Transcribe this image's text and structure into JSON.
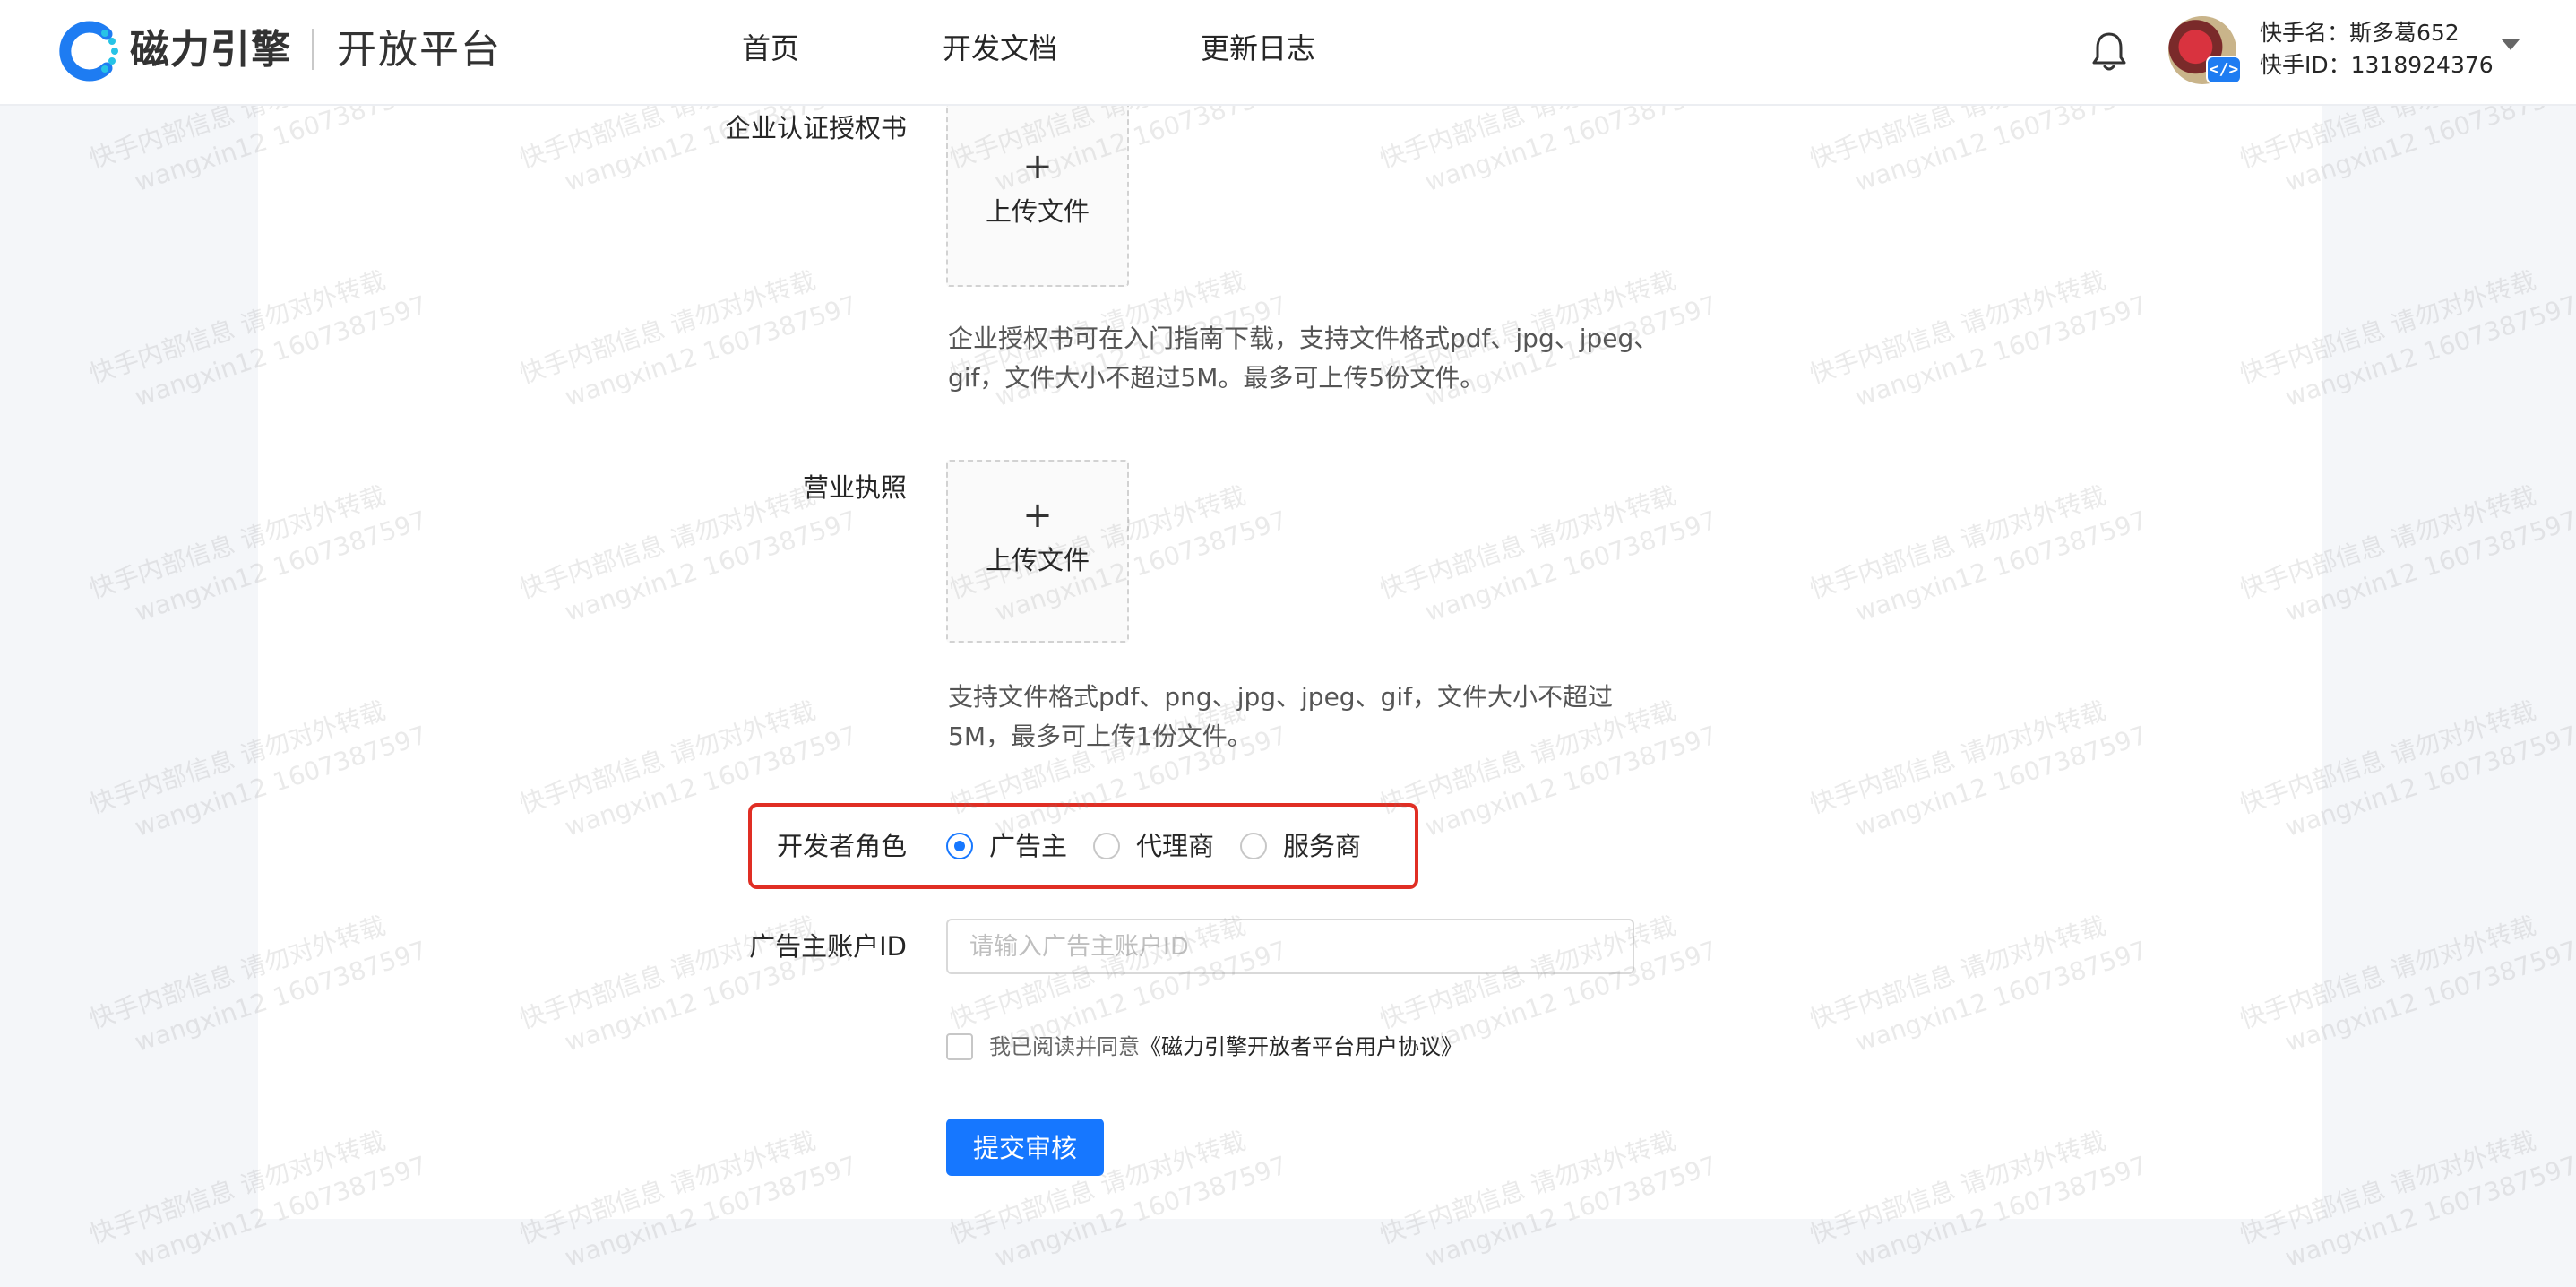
{
  "header": {
    "brand_name": "磁力引擎",
    "platform_name": "开放平台",
    "nav": [
      "首页",
      "开发文档",
      "更新日志"
    ],
    "user": {
      "name_line": "快手名：斯多葛652",
      "id_line": "快手ID：1318924376",
      "avatar_badge": "</>"
    }
  },
  "form": {
    "auth_letter": {
      "label": "企业认证授权书",
      "upload_plus": "+",
      "upload_text": "上传文件",
      "hint": "企业授权书可在入门指南下载，支持文件格式pdf、jpg、jpeg、gif，文件大小不超过5M。最多可上传5份文件。"
    },
    "business_license": {
      "label": "营业执照",
      "upload_plus": "+",
      "upload_text": "上传文件",
      "hint": "支持文件格式pdf、png、jpg、jpeg、gif，文件大小不超过5M，最多可上传1份文件。"
    },
    "developer_role": {
      "label": "开发者角色",
      "options": [
        "广告主",
        "代理商",
        "服务商"
      ],
      "selected": "广告主"
    },
    "advertiser_id": {
      "label": "广告主账户ID",
      "placeholder": "请输入广告主账户ID",
      "value": ""
    },
    "agreement": {
      "prefix": "我已阅读并同意",
      "link": "《磁力引擎开放者平台用户协议》",
      "checked": false
    },
    "submit_label": "提交审核"
  },
  "watermark": {
    "line1": "快手内部信息 请勿对外转载",
    "line2": "wangxin12 1607387597"
  },
  "colors": {
    "primary": "#1677ff",
    "highlight_border": "#e02e24",
    "page_background": "#f4f6f9"
  }
}
